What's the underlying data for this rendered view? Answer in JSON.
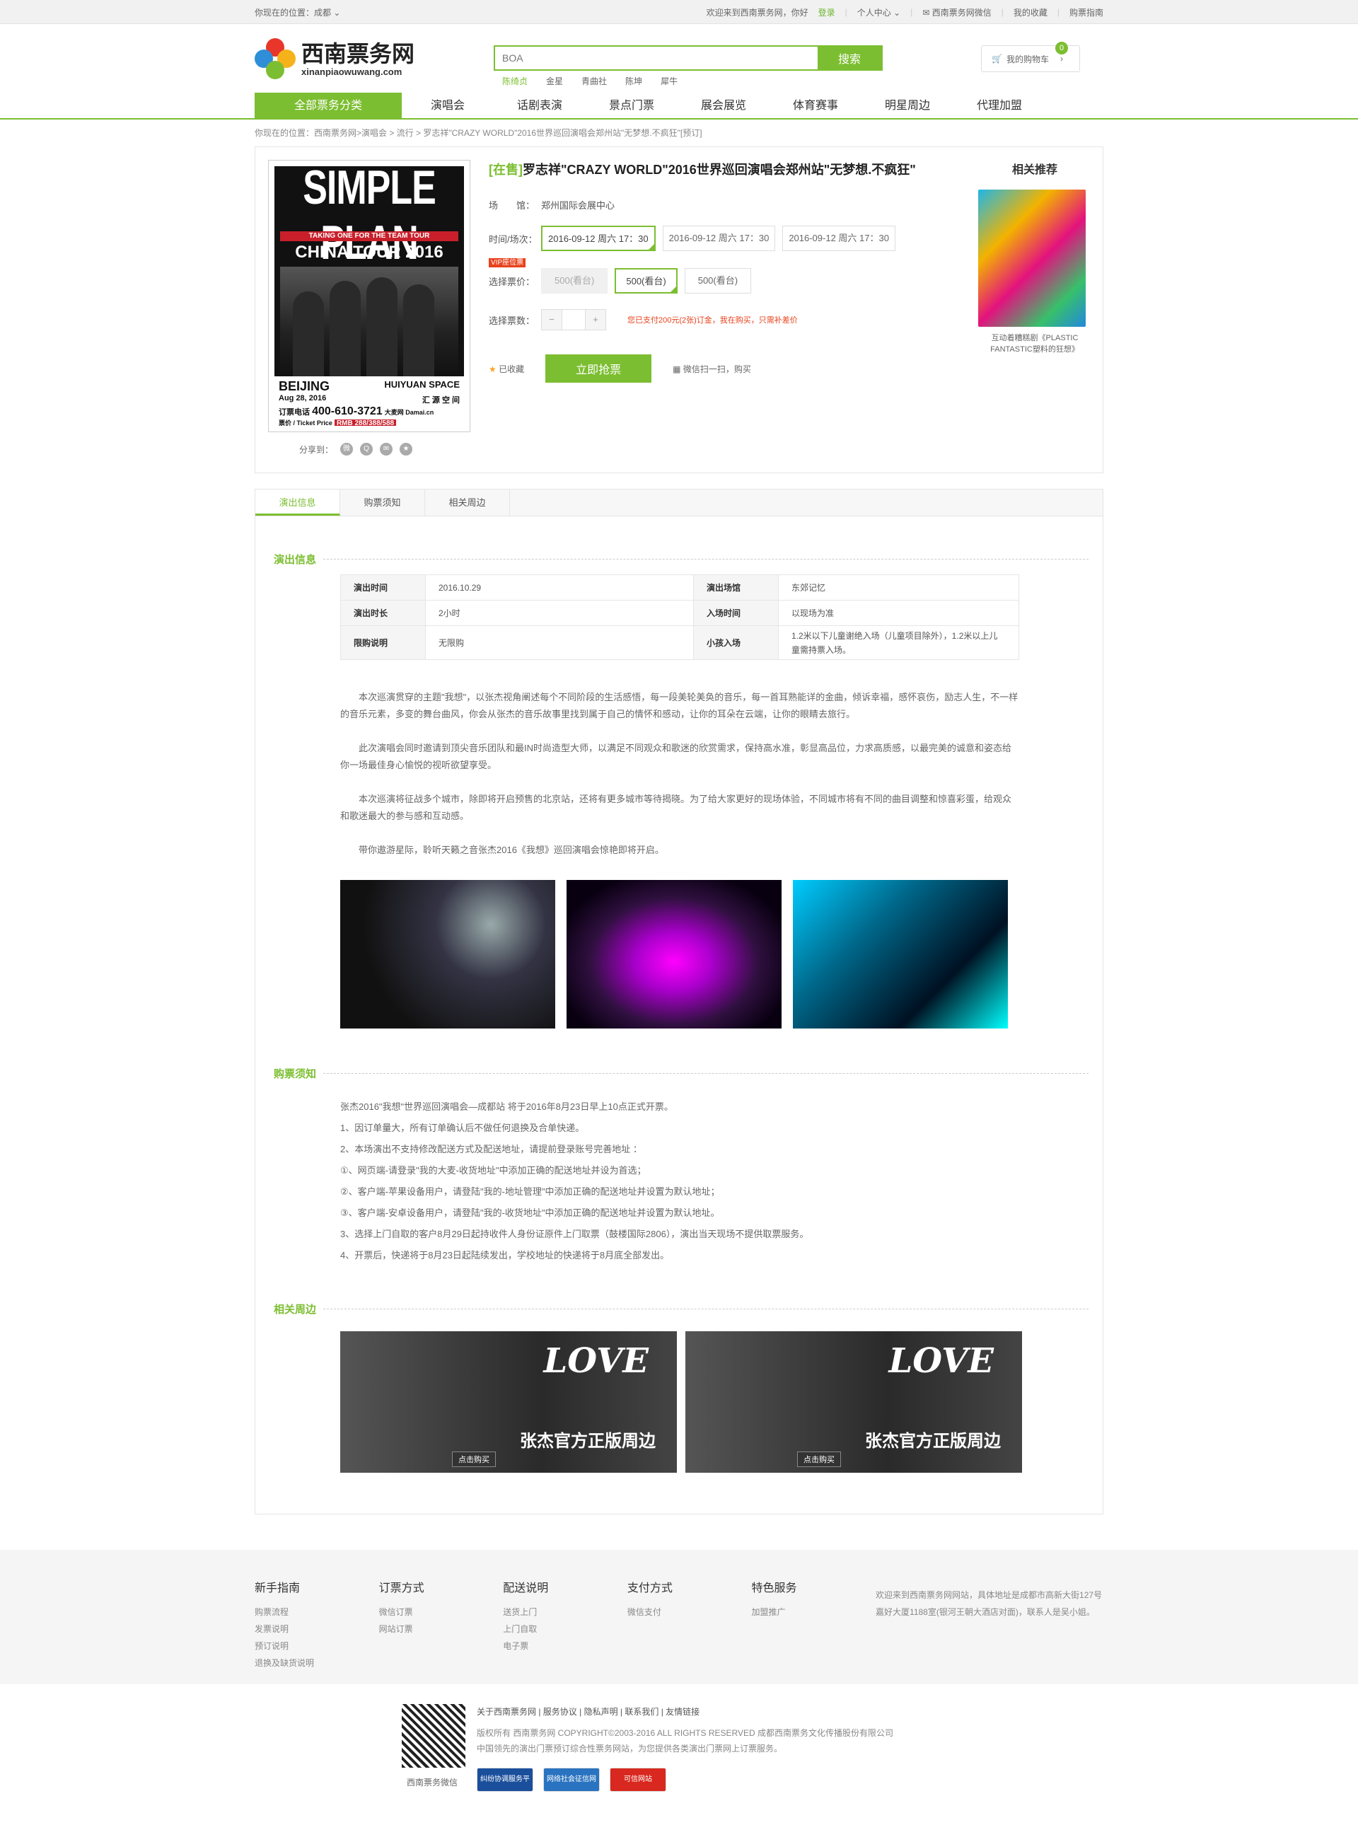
{
  "topbar": {
    "location": "你现在的位置：成都",
    "welcome": "欢迎来到西南票务网，你好",
    "login": "登录",
    "user_center": "个人中心",
    "wechat": "西南票务网微信",
    "favorites": "我的收藏",
    "guide": "购票指南"
  },
  "logo": {
    "title": "西南票务网",
    "sub": "xinanpiaowuwang.com"
  },
  "search": {
    "placeholder": "BOA",
    "button": "搜索",
    "hot": [
      "陈绮贞",
      "金星",
      "青曲社",
      "陈坤",
      "犀牛"
    ]
  },
  "cart": {
    "label": "我的购物车",
    "count": "0"
  },
  "nav": [
    "全部票务分类",
    "演唱会",
    "话剧表演",
    "景点门票",
    "展会展览",
    "体育赛事",
    "明星周边",
    "代理加盟"
  ],
  "breadcrumb": "你现在的位置：西南票务网>演唱会 > 流行 > 罗志祥\"CRAZY WORLD\"2016世界巡回演唱会郑州站\"无梦想.不疯狂\"[预订]",
  "poster": {
    "band": "SIMPLE PLAN",
    "tag": "TAKING ONE FOR THE TEAM TOUR",
    "tour": "CHINA TOUR 2016",
    "city": "BEIJING",
    "venue": "HUIYUAN SPACE",
    "date": "Aug 28, 2016",
    "venue_cn": "汇 源 空 间",
    "hotline_label": "订票电话",
    "phone": "400-610-3721",
    "site": "大麦网 Damai.cn",
    "price_label": "票价 / Ticket Price",
    "price": "RMB 288/388/588"
  },
  "share": {
    "label": "分享到："
  },
  "product": {
    "status": "[在售]",
    "title": "罗志祥\"CRAZY WORLD\"2016世界巡回演唱会郑州站\"无梦想.不疯狂\"",
    "venue_label": "场　　馆：",
    "venue": "郑州国际会展中心",
    "time_label": "时间/场次：",
    "times": [
      "2016-09-12  周六 17：30",
      "2016-09-12  周六 17：30",
      "2016-09-12  周六 17：30"
    ],
    "price_label": "选择票价：",
    "vip": "VIP座位票",
    "prices": [
      "500(看台)",
      "500(看台)",
      "500(看台)"
    ],
    "qty_label": "选择票数：",
    "qty_note": "您已支付200元(2张)订金，我在购买，只需补差价",
    "saved": "已收藏",
    "buy": "立即抢票",
    "wechat_buy": "微信扫一扫，购买"
  },
  "recommend": {
    "title": "相关推荐",
    "caption": "互动着糟糕剧《PLASTIC FANTASTIC塑料的狂想》"
  },
  "tabs": [
    "演出信息",
    "购票须知",
    "相关周边"
  ],
  "sections": {
    "info": "演出信息",
    "notice": "购票须知",
    "merch": "相关周边"
  },
  "info_table": [
    [
      "演出时间",
      "2016.10.29",
      "演出场馆",
      "东郊记忆"
    ],
    [
      "演出时长",
      "2小时",
      "入场时间",
      "以现场为准"
    ],
    [
      "限购说明",
      "无限购",
      "小孩入场",
      "1.2米以下儿童谢绝入场（儿童项目除外），1.2米以上儿童需持票入场。"
    ]
  ],
  "paragraphs": [
    "本次巡演贯穿的主题\"我想\"，以张杰视角阐述每个不同阶段的生活感悟，每一段美轮美奂的音乐，每一首耳熟能详的金曲，倾诉幸福，感怀哀伤，励志人生，不一样的音乐元素，多变的舞台曲风，你会从张杰的音乐故事里找到属于自己的情怀和感动，让你的耳朵在云端，让你的眼睛去旅行。",
    "此次演唱会同时邀请到顶尖音乐团队和最IN时尚造型大师，以满足不同观众和歌迷的欣赏需求，保持高水准，彰显高品位，力求高质感，以最完美的诚意和姿态给你一场最佳身心愉悦的视听欲望享受。",
    "本次巡演将征战多个城市，除即将开启预售的北京站，还将有更多城市等待揭晓。为了给大家更好的现场体验，不同城市将有不同的曲目调整和惊喜彩蛋，给观众和歌迷最大的参与感和互动感。",
    "带你遨游星际，聆听天籁之音张杰2016《我想》巡回演唱会惊艳即将开启。"
  ],
  "rules": [
    "张杰2016\"我想\"世界巡回演唱会—成都站 将于2016年8月23日早上10点正式开票。",
    "1、因订单量大，所有订单确认后不做任何退换及合单快递。",
    "2、本场演出不支持修改配送方式及配送地址，请提前登录账号完善地址 ：",
    "①、网页端-请登录\"我的大麦-收货地址\"中添加正确的配送地址并设为首选；",
    "②、客户端-苹果设备用户，请登陆\"我的-地址管理\"中添加正确的配送地址并设置为默认地址；",
    "③、客户端-安卓设备用户，请登陆\"我的-收货地址\"中添加正确的配送地址并设置为默认地址。",
    "3、选择上门自取的客户8月29日起持收件人身份证原件上门取票（鼓楼国际2806），演出当天现场不提供取票服务。",
    "4、开票后，快递将于8月23日起陆续发出，学校地址的快递将于8月底全部发出。"
  ],
  "merch": {
    "love": "LOVE",
    "title": "张杰官方正版周边",
    "button": "点击购买"
  },
  "footer": {
    "cols": [
      {
        "title": "新手指南",
        "items": [
          "购票流程",
          "发票说明",
          "预订说明",
          "退换及缺货说明"
        ]
      },
      {
        "title": "订票方式",
        "items": [
          "微信订票",
          "网站订票"
        ]
      },
      {
        "title": "配送说明",
        "items": [
          "送货上门",
          "上门自取",
          "电子票"
        ]
      },
      {
        "title": "支付方式",
        "items": [
          "微信支付"
        ]
      },
      {
        "title": "特色服务",
        "items": [
          "加盟推广"
        ]
      }
    ],
    "about": "欢迎来到西南票务网网站，具体地址是成都市高新大街127号嘉好大厦1188室(银河王朝大酒店对面)，联系人是吴小姐。",
    "links": "关于西南票务网 | 服务协议 | 隐私声明 | 联系我们 | 友情链接",
    "copyright": "版权所有 西南票务网 COPYRIGHT©2003-2016 ALL RIGHTS RESERVED 成都西南票务文化传播股份有限公司",
    "slogan": "中国领先的演出门票预订综合性票务网站，为您提供各类演出门票网上订票服务。",
    "qr_label": "西南票务微信",
    "badges": [
      "纠纷协调服务平台",
      "网络社会征信网",
      "可信网站"
    ]
  }
}
